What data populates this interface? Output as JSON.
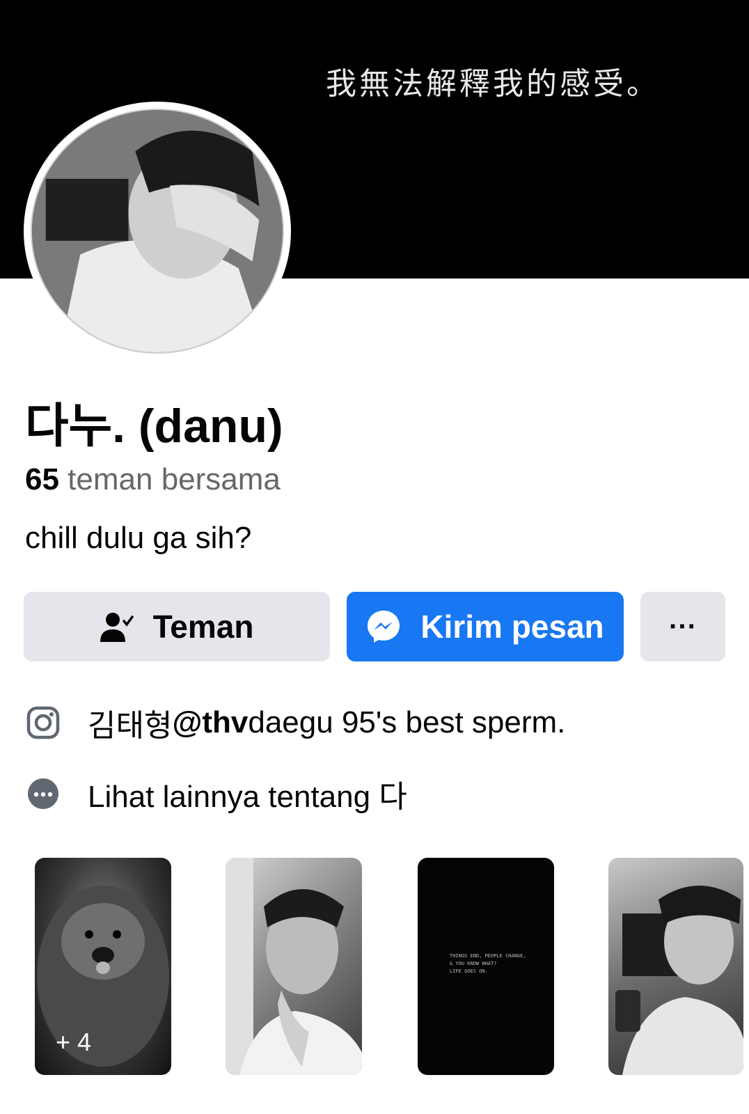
{
  "cover": {
    "caption": "我無法解釋我的感受。"
  },
  "profile": {
    "name": "다누. (danu)",
    "mutual_count": "65",
    "mutual_label": " teman bersama",
    "bio": "chill dulu ga sih?"
  },
  "actions": {
    "friend_label": "Teman",
    "message_label": "Kirim pesan",
    "more_label": "···"
  },
  "details": {
    "instagram_name": "김태형 ",
    "instagram_handle": "@thv",
    "instagram_rest": " daegu 95's best sperm.",
    "see_more": "Lihat lainnya tentang 다"
  },
  "featured": {
    "more_count": "+ 4",
    "quote_text": "THINGS END, PEOPLE CHANGE,\n& YOU KNOW WHAT?\nLIFE GOES ON."
  },
  "colors": {
    "accent": "#1877f2",
    "button_gray": "#e4e6eb",
    "secondary_text": "#65676b"
  }
}
